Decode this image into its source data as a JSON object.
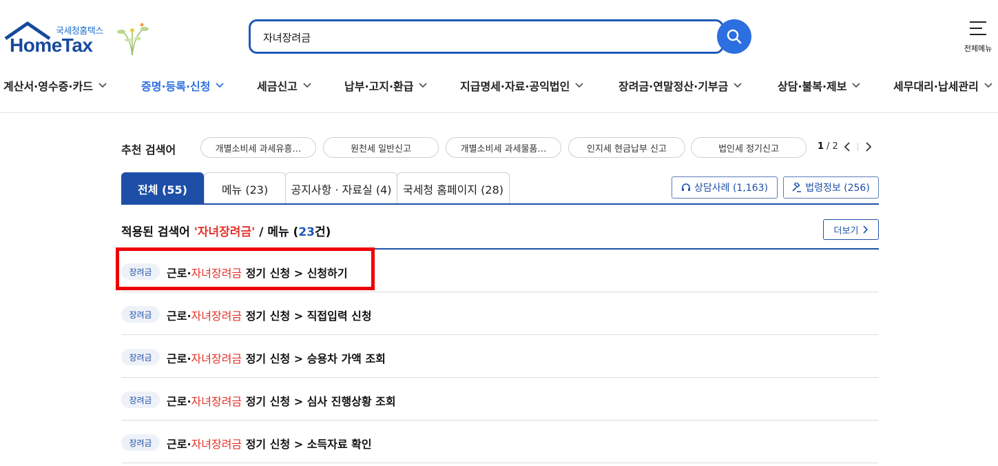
{
  "header": {
    "logo_sub": "국세청홈택스",
    "logo_main": "HomeTax",
    "search_value": "자녀장려금",
    "menu_label": "전체메뉴"
  },
  "nav": {
    "items": [
      {
        "label": "계산서·영수증·카드",
        "active": false
      },
      {
        "label": "증명·등록·신청",
        "active": true
      },
      {
        "label": "세금신고",
        "active": false
      },
      {
        "label": "납부·고지·환급",
        "active": false
      },
      {
        "label": "지급명세·자료·공익법인",
        "active": false
      },
      {
        "label": "장려금·연말정산·기부금",
        "active": false
      },
      {
        "label": "상담·불복·제보",
        "active": false
      },
      {
        "label": "세무대리·납세관리",
        "active": false
      }
    ]
  },
  "recommend": {
    "title": "추천 검색어",
    "chips": [
      "개별소비세 과세유흥…",
      "원천세 일반신고",
      "개별소비세 과세물품…",
      "인지세 현금납부 신고",
      "법인세 정기신고"
    ],
    "page_current": "1",
    "page_total": "/ 2"
  },
  "tabs": {
    "items": [
      "전체 (55)",
      "메뉴 (23)",
      "공지사항 · 자료실 (4)",
      "국세청 홈페이지 (28)"
    ],
    "consult": "상담사례 (1,163)",
    "law": "법령정보 (256)"
  },
  "applied": {
    "prefix": "적용된 검색어 ",
    "keyword": "'자녀장려금'",
    "mid": " / 메뉴 (",
    "count": "23",
    "suffix": "건)",
    "more": "더보기"
  },
  "results": [
    {
      "badge": "장려금",
      "pre": "근로·",
      "hl": "자녀장려금",
      "post": " 정기 신청 > 신청하기"
    },
    {
      "badge": "장려금",
      "pre": "근로·",
      "hl": "자녀장려금",
      "post": " 정기 신청 > 직접입력 신청"
    },
    {
      "badge": "장려금",
      "pre": "근로·",
      "hl": "자녀장려금",
      "post": " 정기 신청 > 승용차 가액 조회"
    },
    {
      "badge": "장려금",
      "pre": "근로·",
      "hl": "자녀장려금",
      "post": " 정기 신청 > 심사 진행상황 조회"
    },
    {
      "badge": "장려금",
      "pre": "근로·",
      "hl": "자녀장려금",
      "post": " 정기 신청 > 소득자료 확인"
    }
  ]
}
